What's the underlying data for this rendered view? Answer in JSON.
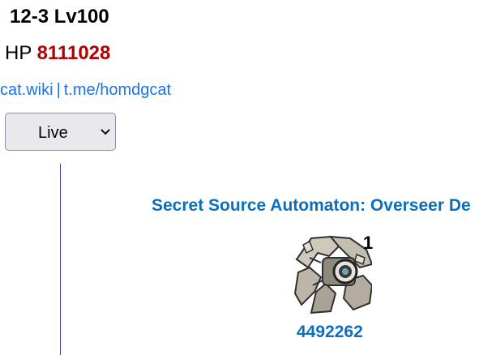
{
  "stage": {
    "title": "12-3 Lv100",
    "hp_label": "HP",
    "hp_value": "8111028"
  },
  "links": {
    "wiki": "cat.wiki",
    "separator": "|",
    "telegram": "t.me/homdgcat"
  },
  "selector": {
    "selected": "Live",
    "icon": "chevron-down-icon"
  },
  "enemy": {
    "name": "Secret Source Automaton: Overseer De",
    "count": "1",
    "hp": "4492262",
    "icon": "automaton-enemy-icon"
  },
  "colors": {
    "hp_value": "#b30000",
    "link": "#1a73e8",
    "enemy_text": "#0b6fbd",
    "timeline": "#3b3bb0",
    "select_bg": "#e9e9ed"
  }
}
